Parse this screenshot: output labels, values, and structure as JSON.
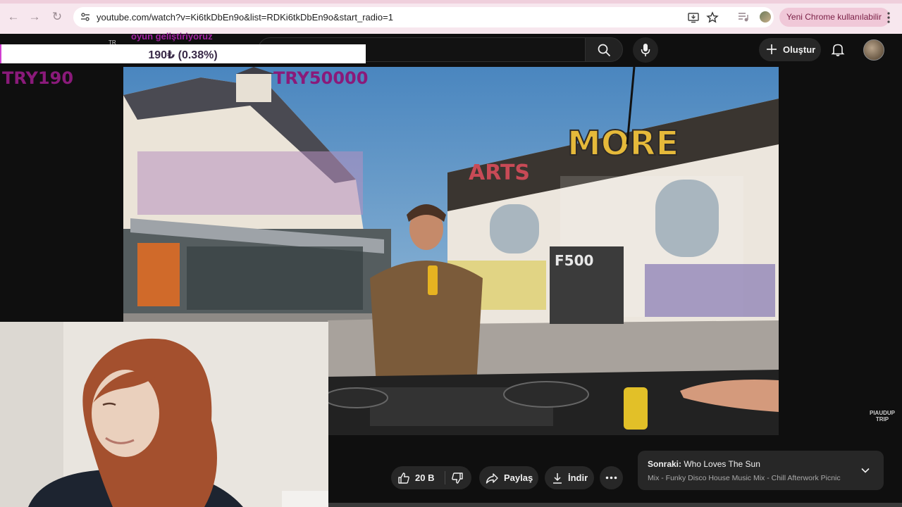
{
  "browser": {
    "url": "youtube.com/watch?v=Ki6tkDbEn9o&list=RDKi6tkDbEn9o&start_radio=1",
    "update_chip_label": "Yeni Chrome kullanılabilir"
  },
  "youtube": {
    "create_label": "Oluştur",
    "like_count": "20 B",
    "share_label": "Paylaş",
    "download_label": "İndir",
    "up_next": {
      "prefix": "Sonraki:",
      "title": "Who Loves The Sun",
      "playlist": "Mix - Funky Disco House Music Mix - Chill Afterwork Picnic"
    }
  },
  "overlay": {
    "caption": "oyun geliştiriyoruz",
    "small_label": "TR",
    "goal_text": "190₺ (0.38%)",
    "goal_progress_percent": 0.38,
    "goal_min": "TRY190",
    "goal_max": "TRY50000",
    "fill_color": "#d040d0",
    "label_color": "#8a1a7a"
  },
  "video": {
    "wall_texts": [
      "ARTS",
      "MORE",
      "F500"
    ],
    "watermark": "PIAUDUP TRIP"
  }
}
